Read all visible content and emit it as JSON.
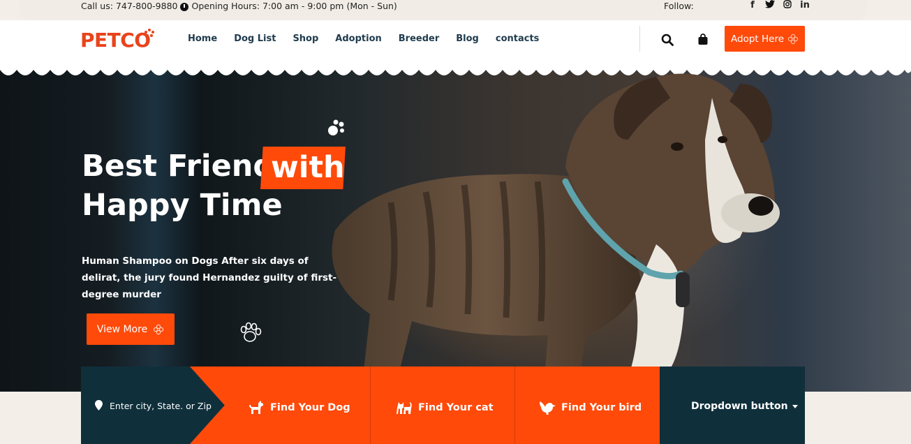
{
  "topbar": {
    "call": "Call us: 747-800-9880",
    "hours": "Opening Hours: 7:00 am - 9:00 pm (Mon - Sun)",
    "follow": "Follow:",
    "socials": [
      {
        "icon": "facebook-icon",
        "glyph": "f"
      },
      {
        "icon": "twitter-icon",
        "glyph": "t"
      },
      {
        "icon": "instagram-icon",
        "glyph": "◎"
      },
      {
        "icon": "linkedin-icon",
        "glyph": "in"
      }
    ]
  },
  "header": {
    "logo": "PETCO",
    "nav": [
      "Home",
      "Dog List",
      "Shop",
      "Adoption",
      "Breeder",
      "Blog",
      "contacts"
    ],
    "adopt_button": "Adopt Here"
  },
  "hero": {
    "title_line1": "Best Friend",
    "title_highlight": "with",
    "title_line2": "Happy Time",
    "subtitle": "Human Shampoo on Dogs After six days of delirat, the jury found Hernandez guilty of first-degree murder",
    "cta": "View More"
  },
  "search_strip": {
    "location_placeholder": "Enter city, State. or Zip",
    "options": [
      "Find Your Dog",
      "Find Your cat",
      "Find Your bird"
    ],
    "dropdown": "Dropdown button"
  },
  "colors": {
    "accent": "#ff4a0a",
    "dark_teal": "#0f2f3b",
    "nav_text": "#1f3b4d",
    "logo": "#e8441c"
  }
}
